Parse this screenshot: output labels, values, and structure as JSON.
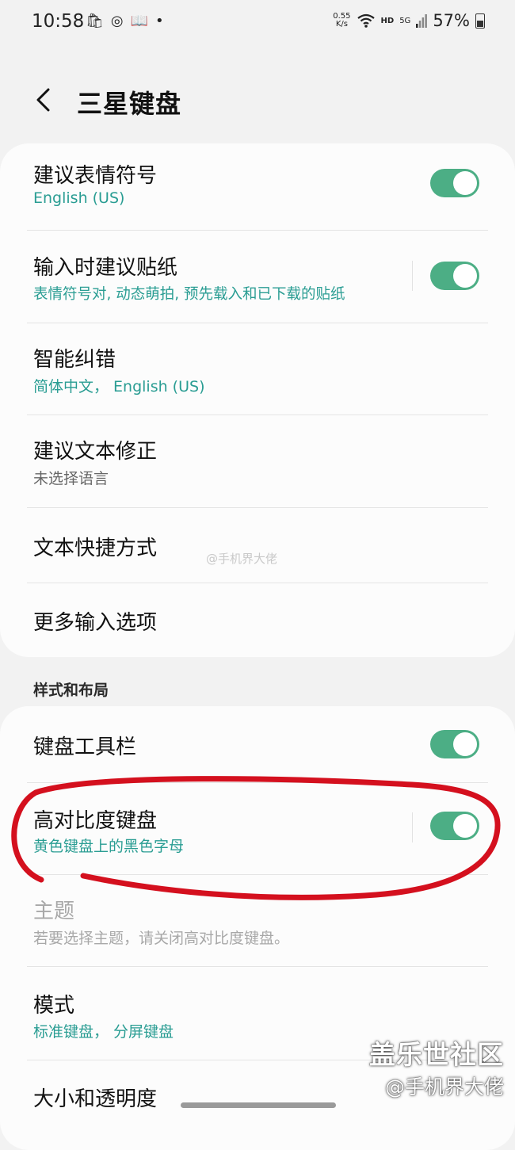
{
  "status": {
    "time": "10:58",
    "notification_icons": [
      "🛍",
      "◎",
      "📖",
      "•"
    ],
    "net_speed_value": "0.55",
    "net_speed_unit": "K/s",
    "hd": "HD",
    "network": "5G",
    "battery": "57%"
  },
  "header": {
    "title": "三星键盘"
  },
  "rows": {
    "emoji": {
      "title": "建议表情符号",
      "subtitle": "English (US)",
      "toggle_on": true
    },
    "sticker": {
      "title": "输入时建议贴纸",
      "subtitle": "表情符号对, 动态萌拍, 预先载入和已下载的贴纸",
      "toggle_on": true
    },
    "autocorrect": {
      "title": "智能纠错",
      "subtitle": "简体中文， English (US)"
    },
    "textcorrect": {
      "title": "建议文本修正",
      "subtitle": "未选择语言"
    },
    "shortcuts": {
      "title": "文本快捷方式"
    },
    "more": {
      "title": "更多输入选项"
    },
    "toolbar": {
      "title": "键盘工具栏",
      "toggle_on": true
    },
    "contrast": {
      "title": "高对比度键盘",
      "subtitle": "黄色键盘上的黑色字母",
      "toggle_on": true
    },
    "theme": {
      "title": "主题",
      "subtitle": "若要选择主题，请关闭高对比度键盘。"
    },
    "mode": {
      "title": "模式",
      "subtitle": "标准键盘， 分屏键盘"
    },
    "size": {
      "title": "大小和透明度"
    }
  },
  "section": {
    "style_layout": "样式和布局"
  },
  "watermarks": {
    "center": "@手机界大佬",
    "brand": "盖乐世社区",
    "author": "@手机界大佬"
  },
  "colors": {
    "accent": "#2a9d93",
    "toggle": "#4cae85",
    "annotation": "#d4101e"
  }
}
